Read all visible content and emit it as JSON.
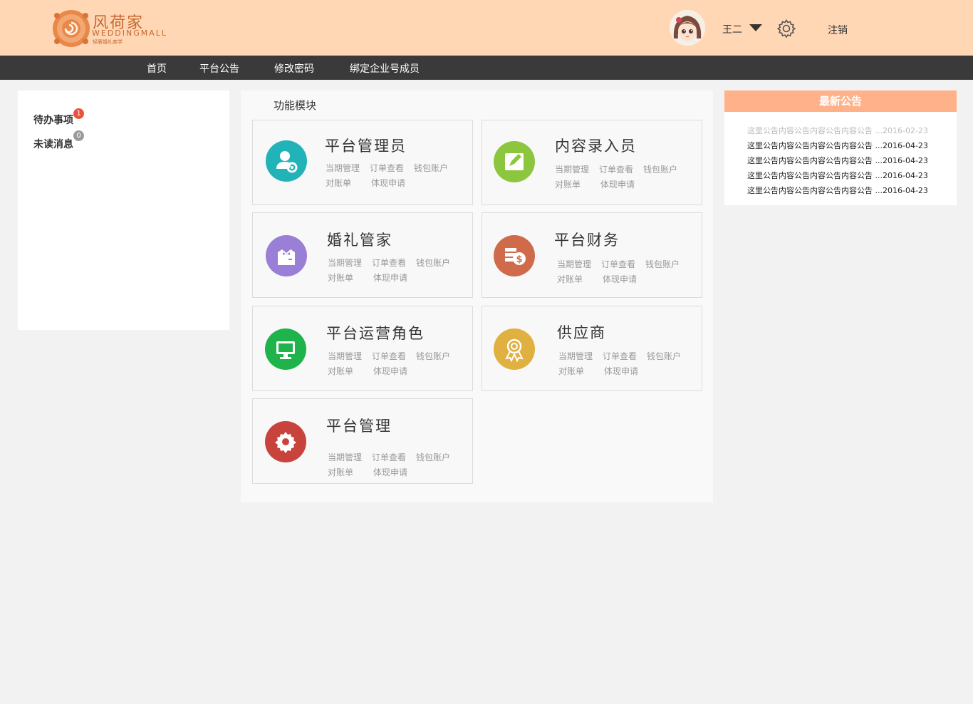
{
  "header": {
    "logo": {
      "cn": "风荷家",
      "en": "WEDDINGMALL",
      "sub": "轻奢婚礼商学"
    },
    "username": "王二",
    "logout": "注销"
  },
  "nav": [
    "首页",
    "平台公告",
    "修改密码",
    "绑定企业号成员"
  ],
  "left": {
    "items": [
      {
        "label": "待办事项",
        "count": "1",
        "color": "#e8523a"
      },
      {
        "label": "未读消息",
        "count": "0",
        "color": "#9b9b9b"
      }
    ]
  },
  "center": {
    "title": "功能模块",
    "cards": [
      {
        "title": "平台管理员",
        "icon": "admin-user-icon",
        "color": "#22b3b8",
        "links": [
          "当期管理",
          "订单查看",
          "钱包账户",
          "对账单",
          "体现申请"
        ]
      },
      {
        "title": "内容录入员",
        "icon": "edit-icon",
        "color": "#8cc63f",
        "links": [
          "当期管理",
          "订单查看",
          "钱包账户",
          "对账单",
          "体现申请"
        ]
      },
      {
        "title": "婚礼管家",
        "icon": "butler-icon",
        "color": "#9a7fd6",
        "links": [
          "当期管理",
          "订单查看",
          "钱包账户",
          "对账单",
          "体现申请"
        ]
      },
      {
        "title": "平台财务",
        "icon": "finance-icon",
        "color": "#cf6b4a",
        "links": [
          "当期管理",
          "订单查看",
          "钱包账户",
          "对账单",
          "体现申请"
        ]
      },
      {
        "title": "平台运营角色",
        "icon": "monitor-icon",
        "color": "#1fb34b",
        "links": [
          "当期管理",
          "订单查看",
          "钱包账户",
          "对账单",
          "体现申请"
        ]
      },
      {
        "title": "供应商",
        "icon": "award-icon",
        "color": "#e0b040",
        "links": [
          "当期管理",
          "订单查看",
          "钱包账户",
          "对账单",
          "体现申请"
        ]
      },
      {
        "title": "平台管理",
        "icon": "gear-icon",
        "color": "#c9433d",
        "links": [
          "当期管理",
          "订单查看",
          "钱包账户",
          "对账单",
          "体现申请"
        ]
      }
    ]
  },
  "right": {
    "title": "最新公告",
    "notices": [
      {
        "text": "这里公告内容公告内容公告内容公告 ...2016-02-23"
      },
      {
        "text": "这里公告内容公告内容公告内容公告 ...2016-04-23"
      },
      {
        "text": "这里公告内容公告内容公告内容公告 ...2016-04-23"
      },
      {
        "text": "这里公告内容公告内容公告内容公告 ...2016-04-23"
      },
      {
        "text": "这里公告内容公告内容公告内容公告 ...2016-04-23"
      }
    ]
  }
}
